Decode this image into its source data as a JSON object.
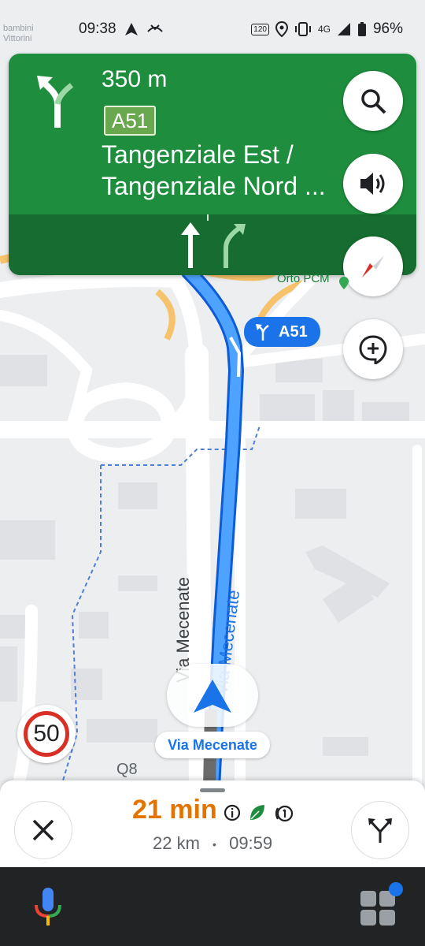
{
  "status_bar": {
    "time": "09:38",
    "faint_text_1": "bambini",
    "faint_text_2": "Vittorini",
    "network": "4G",
    "battery": "96%",
    "hz_badge": "120"
  },
  "nav_banner": {
    "distance": "350 m",
    "route_shield": "A51",
    "road_line_1": "Tangenziale Est /",
    "road_line_2": "Tangenziale Nord ...",
    "lanes": [
      "straight",
      "slight-right"
    ],
    "colors": {
      "banner": "#1e8e3e",
      "lanes": "#176d31"
    }
  },
  "map_controls": {
    "search": "search-icon",
    "sound": "volume-icon",
    "compass": "compass-icon",
    "report": "add-report-icon"
  },
  "map": {
    "route_label": "A51",
    "poi_label": "Orto PCM",
    "street_label_1": "Via Mecenate",
    "street_label_2": "Via Mecenate",
    "current_street": "Via Mecenate",
    "place_label": "Q8",
    "speed_limit": "50",
    "colors": {
      "route": "#1a73e8",
      "map_bg": "#eceef0",
      "roads": "#ffffff",
      "highway": "#f6c26b"
    }
  },
  "trip_sheet": {
    "duration": "21 min",
    "distance": "22 km",
    "separator": "•",
    "arrival": "09:59",
    "colors": {
      "duration": "#e37400"
    }
  },
  "system_bar": {
    "assistant": "mic-icon",
    "apps": "apps-grid-icon"
  }
}
